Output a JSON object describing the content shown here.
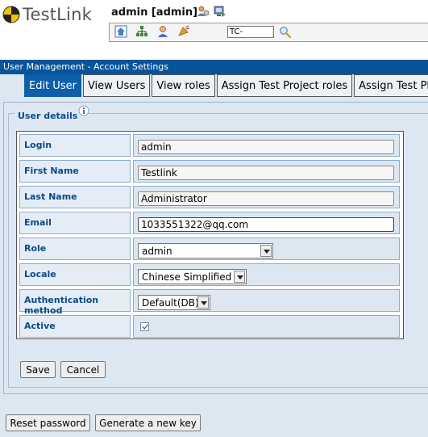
{
  "header": {
    "logo_text": "TestLink",
    "user_info": "admin [admin]",
    "tc_search_value": "TC-"
  },
  "band": {
    "title": "User Management - Account Settings"
  },
  "tabs": [
    {
      "label": "Edit User",
      "active": true
    },
    {
      "label": "View Users",
      "active": false
    },
    {
      "label": "View roles",
      "active": false
    },
    {
      "label": "Assign Test Project roles",
      "active": false
    },
    {
      "label": "Assign Test Pla",
      "active": false
    }
  ],
  "section": {
    "legend": "User details"
  },
  "form": {
    "login": {
      "label": "Login",
      "value": "admin"
    },
    "first_name": {
      "label": "First Name",
      "value": "Testlink"
    },
    "last_name": {
      "label": "Last Name",
      "value": "Administrator"
    },
    "email": {
      "label": "Email",
      "value": "1033551322@qq.com"
    },
    "role": {
      "label": "Role",
      "value": "admin"
    },
    "locale": {
      "label": "Locale",
      "value": "Chinese Simplified"
    },
    "auth": {
      "label": "Authentication method",
      "value": "Default(DB)"
    },
    "active": {
      "label": "Active",
      "checked": true
    }
  },
  "actions": {
    "save": "Save",
    "cancel": "Cancel",
    "reset_password": "Reset password",
    "generate_key": "Generate a new key"
  },
  "colors": {
    "band": "#07549b",
    "active_tab": "#0e5ea8",
    "label_text": "#0b4a8a",
    "page_bg": "#dde7f2"
  }
}
